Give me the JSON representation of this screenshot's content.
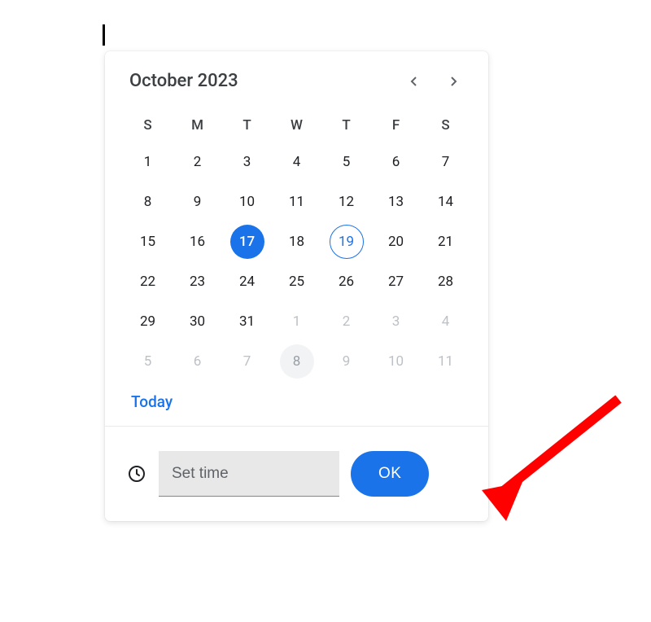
{
  "header": {
    "month_label": "October 2023"
  },
  "weekdays": [
    "S",
    "M",
    "T",
    "W",
    "T",
    "F",
    "S"
  ],
  "days": [
    {
      "n": "1",
      "state": "current"
    },
    {
      "n": "2",
      "state": "current"
    },
    {
      "n": "3",
      "state": "current"
    },
    {
      "n": "4",
      "state": "current"
    },
    {
      "n": "5",
      "state": "current"
    },
    {
      "n": "6",
      "state": "current"
    },
    {
      "n": "7",
      "state": "current"
    },
    {
      "n": "8",
      "state": "current"
    },
    {
      "n": "9",
      "state": "current"
    },
    {
      "n": "10",
      "state": "current"
    },
    {
      "n": "11",
      "state": "current"
    },
    {
      "n": "12",
      "state": "current"
    },
    {
      "n": "13",
      "state": "current"
    },
    {
      "n": "14",
      "state": "current"
    },
    {
      "n": "15",
      "state": "current"
    },
    {
      "n": "16",
      "state": "current"
    },
    {
      "n": "17",
      "state": "selected"
    },
    {
      "n": "18",
      "state": "current"
    },
    {
      "n": "19",
      "state": "today"
    },
    {
      "n": "20",
      "state": "current"
    },
    {
      "n": "21",
      "state": "current"
    },
    {
      "n": "22",
      "state": "current"
    },
    {
      "n": "23",
      "state": "current"
    },
    {
      "n": "24",
      "state": "current"
    },
    {
      "n": "25",
      "state": "current"
    },
    {
      "n": "26",
      "state": "current"
    },
    {
      "n": "27",
      "state": "current"
    },
    {
      "n": "28",
      "state": "current"
    },
    {
      "n": "29",
      "state": "current"
    },
    {
      "n": "30",
      "state": "current"
    },
    {
      "n": "31",
      "state": "current"
    },
    {
      "n": "1",
      "state": "other"
    },
    {
      "n": "2",
      "state": "other"
    },
    {
      "n": "3",
      "state": "other"
    },
    {
      "n": "4",
      "state": "other"
    },
    {
      "n": "5",
      "state": "other"
    },
    {
      "n": "6",
      "state": "other"
    },
    {
      "n": "7",
      "state": "other"
    },
    {
      "n": "8",
      "state": "other-hover"
    },
    {
      "n": "9",
      "state": "other"
    },
    {
      "n": "10",
      "state": "other"
    },
    {
      "n": "11",
      "state": "other"
    }
  ],
  "today_label": "Today",
  "footer": {
    "time_placeholder": "Set time",
    "ok_label": "OK"
  }
}
